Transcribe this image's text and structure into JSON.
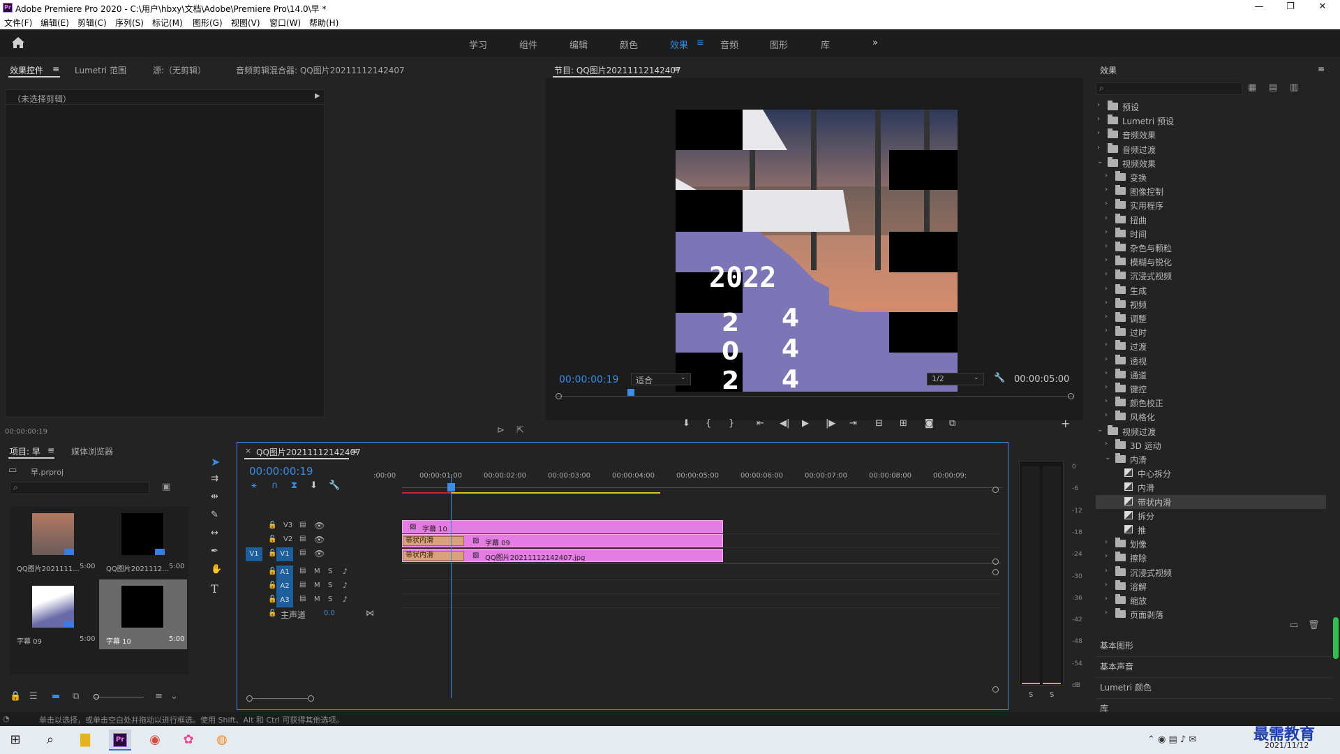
{
  "window": {
    "title": "Adobe Premiere Pro 2020 - C:\\用户\\hbxy\\文档\\Adobe\\Premiere Pro\\14.0\\早 *",
    "app_icon": "Pr"
  },
  "menu": [
    "文件(F)",
    "编辑(E)",
    "剪辑(C)",
    "序列(S)",
    "标记(M)",
    "图形(G)",
    "视图(V)",
    "窗口(W)",
    "帮助(H)"
  ],
  "workspaces": {
    "items": [
      "学习",
      "组件",
      "编辑",
      "颜色",
      "效果",
      "音频",
      "图形",
      "库"
    ],
    "active": "效果",
    "more": "»"
  },
  "effect_controls": {
    "tabs": [
      "效果控件",
      "Lumetri 范围",
      "源:（无剪辑）",
      "音频剪辑混合器: QQ图片20211112142407"
    ],
    "no_clip": "（未选择剪辑）",
    "timecode": "00:00:00:19"
  },
  "program": {
    "title": "节目: QQ图片20211112142407",
    "timecode": "00:00:00:19",
    "fit": "适合",
    "resolution": "1/2",
    "duration": "00:00:05:00",
    "frame_text": {
      "year": "2022",
      "col1": [
        "2",
        "0",
        "2"
      ],
      "col2": [
        "4",
        "4",
        "4"
      ]
    }
  },
  "project": {
    "tabs": [
      "项目: 早",
      "媒体浏览器"
    ],
    "file": "早.prproj",
    "items": [
      {
        "name": "QQ图片2021111...",
        "dur": "5:00"
      },
      {
        "name": "QQ图片2021112...",
        "dur": "5:00"
      },
      {
        "name": "字幕 09",
        "dur": "5:00"
      },
      {
        "name": "字幕 10",
        "dur": "5:00"
      }
    ]
  },
  "timeline": {
    "title": "QQ图片20211112142407",
    "timecode": "00:00:00:19",
    "ruler": [
      ":00:00",
      "00:00:01:00",
      "00:00:02:00",
      "00:00:03:00",
      "00:00:04:00",
      "00:00:05:00",
      "00:00:06:00",
      "00:00:07:00",
      "00:00:08:00",
      "00:00:09:"
    ],
    "video_tracks": [
      "V3",
      "V2",
      "V1"
    ],
    "audio_tracks": [
      "A1",
      "A2",
      "A3"
    ],
    "source_patch": "V1",
    "master": "主声道",
    "master_val": "0.0",
    "clips": {
      "v3": "字幕 10",
      "v2": "字幕 09",
      "v1": "QQ图片20211112142407.jpg",
      "transition": "带状内滑"
    }
  },
  "meters": {
    "labels": [
      "0",
      "-6",
      "-12",
      "-18",
      "-24",
      "-30",
      "-36",
      "-42",
      "-48",
      "-54",
      "dB"
    ],
    "solo": [
      "S",
      "S"
    ]
  },
  "effects": {
    "title": "效果",
    "tree": [
      {
        "label": "预设",
        "level": 0,
        "type": "folder",
        "open": false
      },
      {
        "label": "Lumetri 预设",
        "level": 0,
        "type": "folder",
        "open": false
      },
      {
        "label": "音频效果",
        "level": 0,
        "type": "folder",
        "open": false
      },
      {
        "label": "音频过渡",
        "level": 0,
        "type": "folder",
        "open": false
      },
      {
        "label": "视频效果",
        "level": 0,
        "type": "folder",
        "open": true
      },
      {
        "label": "变换",
        "level": 1,
        "type": "folder",
        "open": false
      },
      {
        "label": "图像控制",
        "level": 1,
        "type": "folder",
        "open": false
      },
      {
        "label": "实用程序",
        "level": 1,
        "type": "folder",
        "open": false
      },
      {
        "label": "扭曲",
        "level": 1,
        "type": "folder",
        "open": false
      },
      {
        "label": "时间",
        "level": 1,
        "type": "folder",
        "open": false
      },
      {
        "label": "杂色与颗粒",
        "level": 1,
        "type": "folder",
        "open": false
      },
      {
        "label": "模糊与锐化",
        "level": 1,
        "type": "folder",
        "open": false
      },
      {
        "label": "沉浸式视频",
        "level": 1,
        "type": "folder",
        "open": false
      },
      {
        "label": "生成",
        "level": 1,
        "type": "folder",
        "open": false
      },
      {
        "label": "视频",
        "level": 1,
        "type": "folder",
        "open": false
      },
      {
        "label": "调整",
        "level": 1,
        "type": "folder",
        "open": false
      },
      {
        "label": "过时",
        "level": 1,
        "type": "folder",
        "open": false
      },
      {
        "label": "过渡",
        "level": 1,
        "type": "folder",
        "open": false
      },
      {
        "label": "透视",
        "level": 1,
        "type": "folder",
        "open": false
      },
      {
        "label": "通道",
        "level": 1,
        "type": "folder",
        "open": false
      },
      {
        "label": "键控",
        "level": 1,
        "type": "folder",
        "open": false
      },
      {
        "label": "颜色校正",
        "level": 1,
        "type": "folder",
        "open": false
      },
      {
        "label": "风格化",
        "level": 1,
        "type": "folder",
        "open": false
      },
      {
        "label": "视频过渡",
        "level": 0,
        "type": "folder",
        "open": true
      },
      {
        "label": "3D 运动",
        "level": 1,
        "type": "folder",
        "open": false
      },
      {
        "label": "内滑",
        "level": 1,
        "type": "folder",
        "open": true
      },
      {
        "label": "中心拆分",
        "level": 2,
        "type": "effect"
      },
      {
        "label": "内滑",
        "level": 2,
        "type": "effect"
      },
      {
        "label": "带状内滑",
        "level": 2,
        "type": "effect",
        "selected": true
      },
      {
        "label": "拆分",
        "level": 2,
        "type": "effect"
      },
      {
        "label": "推",
        "level": 2,
        "type": "effect"
      },
      {
        "label": "划像",
        "level": 1,
        "type": "folder",
        "open": false
      },
      {
        "label": "擦除",
        "level": 1,
        "type": "folder",
        "open": false
      },
      {
        "label": "沉浸式视频",
        "level": 1,
        "type": "folder",
        "open": false
      },
      {
        "label": "溶解",
        "level": 1,
        "type": "folder",
        "open": false
      },
      {
        "label": "缩放",
        "level": 1,
        "type": "folder",
        "open": false
      },
      {
        "label": "页面剥落",
        "level": 1,
        "type": "folder",
        "open": false
      }
    ],
    "sections": [
      "基本图形",
      "基本声音",
      "Lumetri 颜色",
      "库"
    ]
  },
  "status": "单击以选择，或单击空白处并拖动以进行框选。使用 Shift、Alt 和 Ctrl 可获得其他选项。",
  "taskbar": {
    "date": "2021/11/12",
    "watermark": "最需教育"
  },
  "colors": {
    "accent": "#2d8ceb",
    "clip": "#e47ce4",
    "transition": "#d8a37a",
    "playhead": "#3a8de6"
  }
}
